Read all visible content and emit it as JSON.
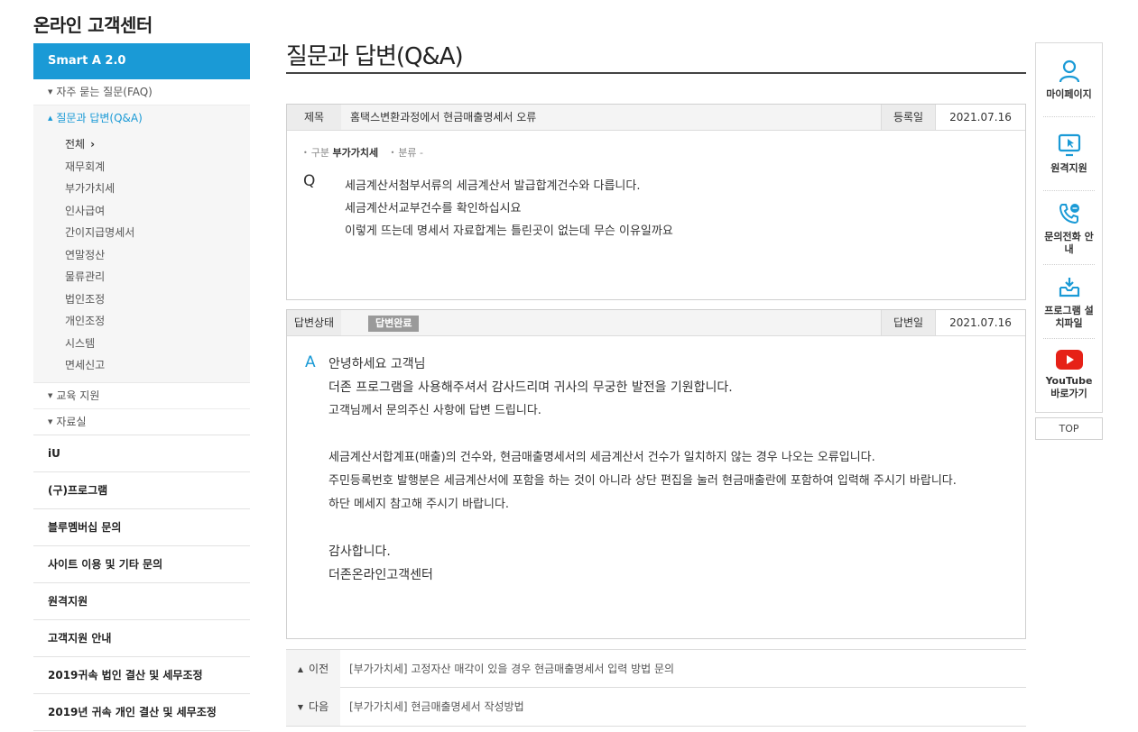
{
  "site": {
    "title": "온라인 고객센터"
  },
  "sidebar": {
    "header": "Smart A 2.0",
    "faq": "자주 묻는 질문(FAQ)",
    "qna": "질문과 답변(Q&A)",
    "qna_items": [
      {
        "label": "전체"
      },
      {
        "label": "재무회계"
      },
      {
        "label": "부가가치세"
      },
      {
        "label": "인사급여"
      },
      {
        "label": "간이지급명세서"
      },
      {
        "label": "연말정산"
      },
      {
        "label": "물류관리"
      },
      {
        "label": "법인조정"
      },
      {
        "label": "개인조정"
      },
      {
        "label": "시스템"
      },
      {
        "label": "면세신고"
      }
    ],
    "edu": "교육 지원",
    "library": "자료실",
    "main_items": [
      {
        "label": "iU"
      },
      {
        "label": "(구)프로그램"
      },
      {
        "label": "블루멤버십 문의"
      },
      {
        "label": "사이트 이용 및 기타 문의"
      },
      {
        "label": "원격지원"
      },
      {
        "label": "고객지원 안내"
      },
      {
        "label": "2019귀속 법인 결산 및 세무조정"
      },
      {
        "label": "2019년 귀속 개인 결산 및 세무조정"
      }
    ]
  },
  "page": {
    "title": "질문과 답변(Q&A)"
  },
  "question": {
    "subject_label": "제목",
    "subject": "홈택스변환과정에서 현금매출명세서 오류",
    "date_label": "등록일",
    "date": "2021.07.16",
    "category_label": "구분",
    "category": "부가가치세",
    "class_label": "분류",
    "class": "-",
    "mark": "Q",
    "lines": [
      "세금계산서첨부서류의 세금계산서 발급합계건수와 다릅니다.",
      "세금계산서교부건수를 확인하십시요",
      "이렇게 뜨는데  명세서 자료합계는 틀린곳이 없는데  무슨 이유일까요"
    ]
  },
  "answer": {
    "status_label": "답변상태",
    "status": "답변완료",
    "date_label": "답변일",
    "date": "2021.07.16",
    "mark": "A",
    "line1": "안녕하세요 고객님",
    "line2": "더존 프로그램을 사용해주셔서 감사드리며 귀사의 무궁한 발전을 기원합니다.",
    "line3": "고객님께서 문의주신 사항에 답변 드립니다.",
    "line4": "세금계산서합계표(매출)의 건수와, 현금매출명세서의 세금계산서 건수가 일치하지 않는 경우 나오는 오류입니다.",
    "line5": "주민등록번호 발행분은 세금계산서에 포함을 하는 것이 아니라 상단 편집을 눌러 현금매출란에 포함하여 입력해 주시기 바랍니다.",
    "line6": "하단 메세지 참고해 주시기 바랍니다.",
    "line7": "감사합니다.",
    "line8": "더존온라인고객센터"
  },
  "nav": {
    "prev_label": "이전",
    "prev_text": "[부가가치세] 고정자산 매각이 있을 경우 현금매출명세서 입력 방법 문의",
    "next_label": "다음",
    "next_text": "[부가가치세] 현금매출명세서 작성방법"
  },
  "rail": {
    "mypage": "마이페이지",
    "remote": "원격지원",
    "phone": "문의전화 안내",
    "install": "프로그램 설치파일",
    "youtube": "YouTube 바로가기",
    "top": "TOP"
  },
  "colors": {
    "accent": "#1a9ad6",
    "youtube": "#e62117"
  }
}
